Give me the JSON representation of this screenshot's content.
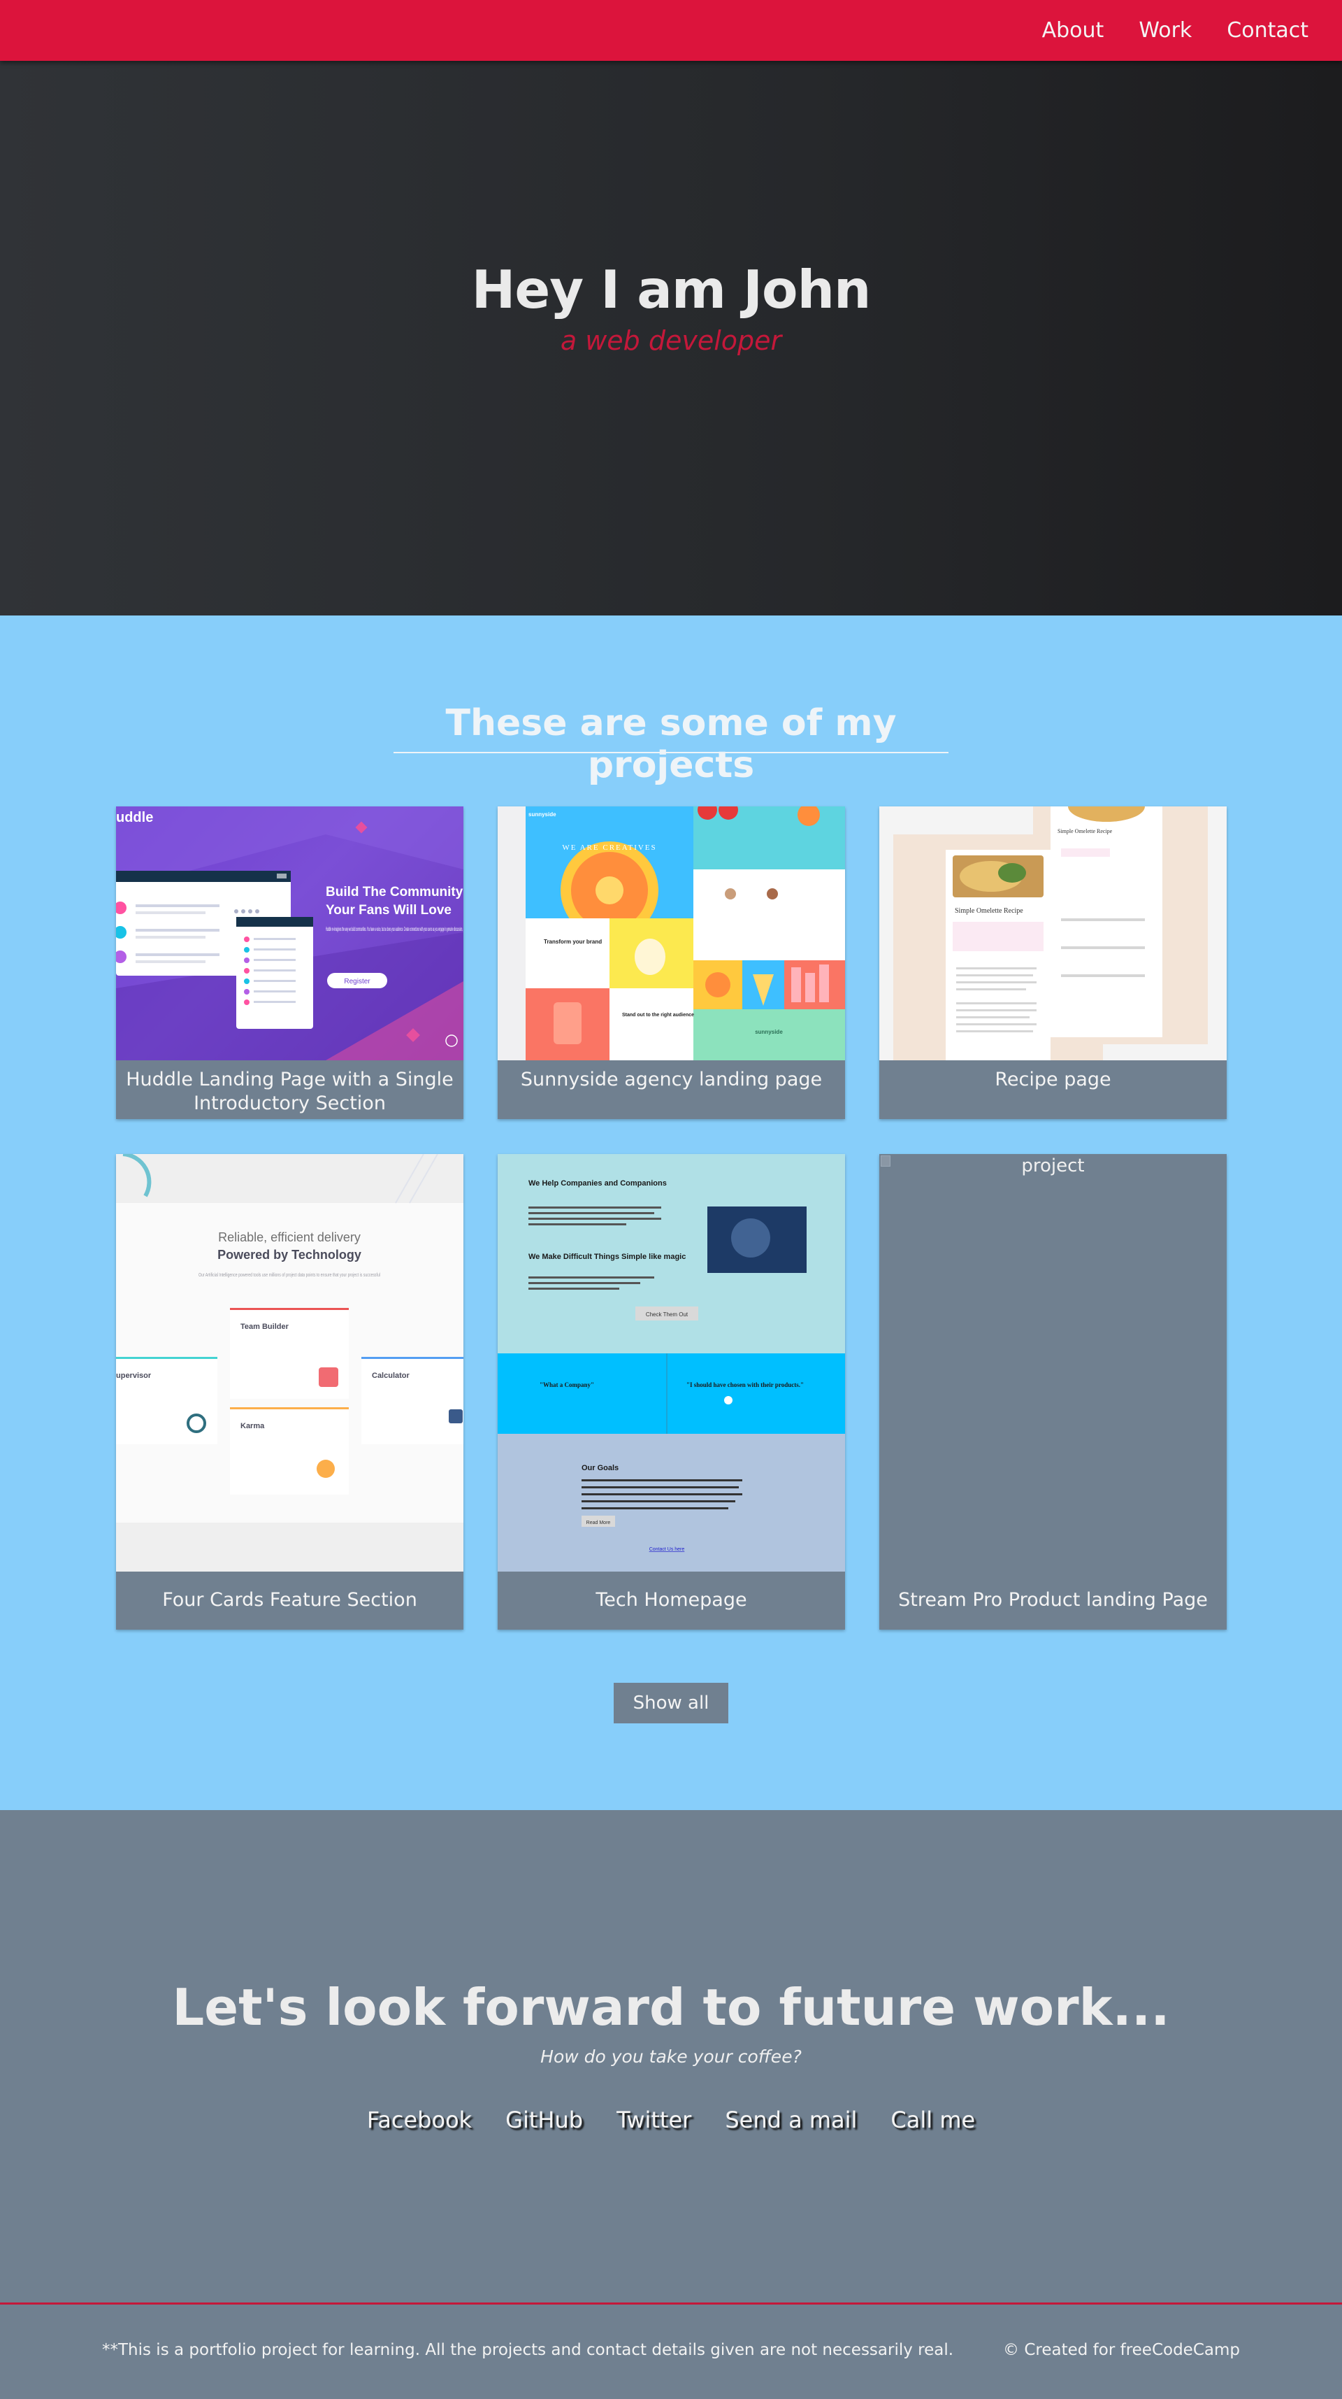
{
  "nav": {
    "links": [
      "About",
      "Work",
      "Contact"
    ]
  },
  "hero": {
    "title": "Hey I am John",
    "subtitle": "a web developer"
  },
  "projects": {
    "heading": "These are some of my projects",
    "cards": [
      {
        "label": "Huddle Landing Page with a Single Introductory Section",
        "thumb": {
          "logo": "uddle",
          "headline1": "Build The Community",
          "headline2": "Your Fans Will Love",
          "body": "Huddle re-imagines the way we build communities. You have a voice, but so does your audience. Create connections with your users as you engage in genuine discussion.",
          "button": "Register"
        }
      },
      {
        "label": "Sunnyside agency landing page",
        "thumb": {
          "logo": "sunnyside",
          "hero": "WE ARE CREATIVES",
          "tile1": "Transform your brand",
          "tile2": "Stand out to the right audience",
          "brand": "sunnyside"
        }
      },
      {
        "label": "Recipe page",
        "thumb": {
          "title": "Simple Omelette Recipe",
          "back_title": "Simple Omelette Recipe"
        }
      },
      {
        "label": "Four Cards Feature Section",
        "thumb": {
          "line1": "Reliable, efficient delivery",
          "line2": "Powered by Technology",
          "desc": "Our Artificial Intelligence powered tools use millions of project data points to ensure that your project is successful",
          "card_left": "upervisor",
          "card_team": "Team Builder",
          "card_karma": "Karma",
          "card_calc": "Calculator"
        }
      },
      {
        "label": "Tech Homepage",
        "thumb": {
          "h1": "We Help Companies and Companions",
          "h2": "We Make Difficult Things Simple like magic",
          "btn": "Check Them Out",
          "q1": "\"What a Company\"",
          "q2": "\"I should have chosen with their products.\"",
          "goals": "Our Goals",
          "goals_btn": "Read More",
          "link": "Contact Us here"
        }
      },
      {
        "label": "Stream Pro Product landing Page",
        "thumb": {
          "alt": "project"
        }
      }
    ],
    "show_all": "Show all"
  },
  "contact": {
    "title": "Let's look forward to future work...",
    "subtitle": "How do you take your coffee?",
    "links": [
      "Facebook",
      "GitHub",
      "Twitter",
      "Send a mail",
      "Call me"
    ]
  },
  "footer": {
    "note": "**This is a portfolio project for learning. All the projects and contact details given are not necessarily real.",
    "credit": "© Created for freeCodeCamp"
  },
  "colors": {
    "nav": "#dc143c",
    "accent": "#c4183a",
    "projects_bg": "#87cefa",
    "slate": "#708090"
  }
}
